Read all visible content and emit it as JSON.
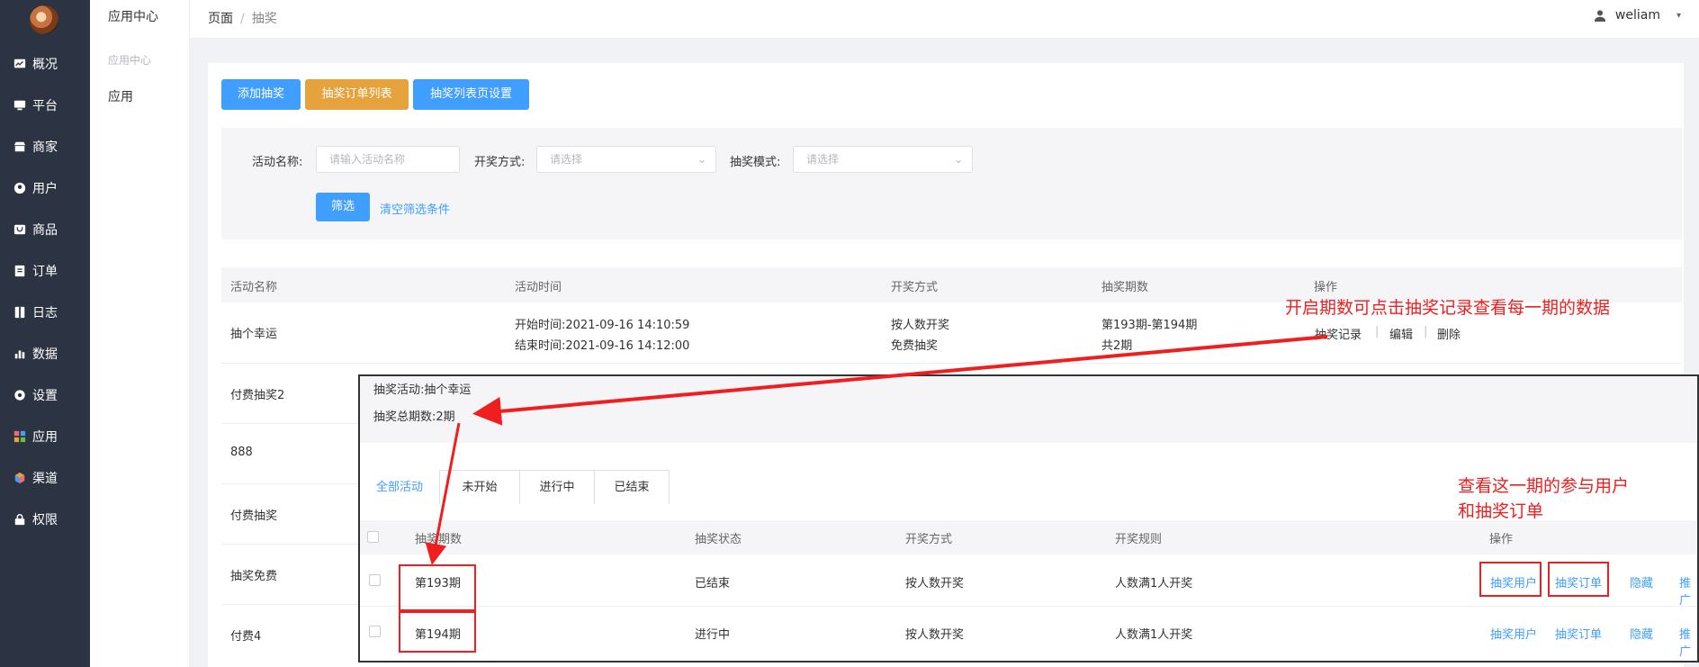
{
  "sidebar": {
    "items": [
      {
        "label": "概况",
        "icon": "dashboard-icon"
      },
      {
        "label": "平台",
        "icon": "monitor-icon"
      },
      {
        "label": "商家",
        "icon": "store-icon"
      },
      {
        "label": "用户",
        "icon": "user-icon"
      },
      {
        "label": "商品",
        "icon": "goods-icon"
      },
      {
        "label": "订单",
        "icon": "order-icon"
      },
      {
        "label": "日志",
        "icon": "log-icon"
      },
      {
        "label": "数据",
        "icon": "chart-icon"
      },
      {
        "label": "设置",
        "icon": "gear-icon"
      },
      {
        "label": "应用",
        "icon": "apps-icon"
      },
      {
        "label": "渠道",
        "icon": "cube-icon"
      },
      {
        "label": "权限",
        "icon": "lock-icon"
      }
    ]
  },
  "subsidebar": {
    "title": "应用中心",
    "group": "应用中心",
    "item": "应用"
  },
  "header": {
    "crumb_root": "页面",
    "crumb_sep": "/",
    "crumb_current": "抽奖",
    "username": "weliam",
    "caret": "▾"
  },
  "toolbar": {
    "add": "添加抽奖",
    "orders": "抽奖订单列表",
    "settings": "抽奖列表页设置"
  },
  "filters": {
    "name_label": "活动名称:",
    "name_placeholder": "请输入活动名称",
    "method_label": "开奖方式:",
    "method_placeholder": "请选择",
    "mode_label": "抽奖模式:",
    "mode_placeholder": "请选择",
    "submit": "筛选",
    "clear": "清空筛选条件"
  },
  "table": {
    "headers": {
      "name": "活动名称",
      "time": "活动时间",
      "method": "开奖方式",
      "periods": "抽奖期数",
      "actions": "操作"
    },
    "first_row": {
      "name": "抽个幸运",
      "start": "开始时间:2021-09-16 14:10:59",
      "end": "结束时间:2021-09-16 14:12:00",
      "method1": "按人数开奖",
      "method2": "免费抽奖",
      "period_range": "第193期-第194期",
      "period_total": "共2期",
      "act_records": "抽奖记录",
      "act_edit": "编辑",
      "act_delete": "删除",
      "sep": "|"
    },
    "other_names": [
      "付费抽奖2",
      "888",
      "付费抽奖",
      "抽奖免费",
      "付费4"
    ]
  },
  "overlay": {
    "activity": "抽奖活动:抽个幸运",
    "total": "抽奖总期数:2期",
    "tabs": [
      "全部活动",
      "未开始",
      "进行中",
      "已结束"
    ],
    "headers": {
      "period": "抽奖期数",
      "status": "抽奖状态",
      "method": "开奖方式",
      "rule": "开奖规则",
      "actions": "操作"
    },
    "rows": [
      {
        "period": "第193期",
        "status": "已结束",
        "method": "按人数开奖",
        "rule": "人数满1人开奖",
        "a1": "抽奖用户",
        "a2": "抽奖订单",
        "a3": "隐藏",
        "a4": "推广"
      },
      {
        "period": "第194期",
        "status": "进行中",
        "method": "按人数开奖",
        "rule": "人数满1人开奖",
        "a1": "抽奖用户",
        "a2": "抽奖订单",
        "a3": "隐藏",
        "a4": "推广"
      }
    ]
  },
  "annotations": {
    "top": "开启期数可点击抽奖记录查看每一期的数据",
    "right_line1": "查看这一期的参与用户",
    "right_line2": "和抽奖订单",
    "color": "#f01e1e"
  },
  "colors": {
    "primary": "#409eff",
    "warning": "#e6a23c",
    "sidebar": "#2c3443"
  }
}
